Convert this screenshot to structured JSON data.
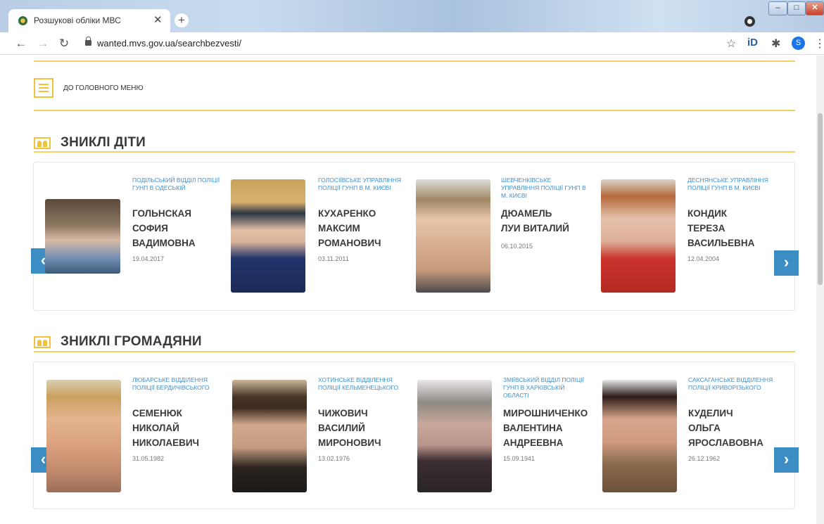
{
  "browser": {
    "tab_title": "Розшукові обліки МВС",
    "url": "wanted.mvs.gov.ua/searchbezvesti/",
    "profile_initial": "S"
  },
  "page": {
    "menu_link": "ДО ГОЛОВНОГО МЕНЮ",
    "sections": [
      {
        "title": "ЗНИКЛІ ДІТИ",
        "cards": [
          {
            "dept": "ПОДІЛЬСЬКИЙ ВІДДІЛ ПОЛІЦІЇ ГУНП В ОДЕСЬКІЙ",
            "name": [
              "ГОЛЬНСКАЯ",
              "СОФИЯ",
              "ВАДИМОВНА"
            ],
            "date": "19.04.2017"
          },
          {
            "dept": "ГОЛОСІЇВСЬКЕ УПРАВЛІННЯ ПОЛІЦІЇ ГУНП В М. КИЄВІ",
            "name": [
              "КУХАРЕНКО",
              "МАКСИМ",
              "РОМАНОВИЧ"
            ],
            "date": "03.11.2011"
          },
          {
            "dept": "ШЕВЧЕНКІВСЬКЕ УПРАВЛІННЯ ПОЛІЦІЇ ГУНП В М. КИЄВІ",
            "name": [
              "ДЮАМЕЛЬ",
              "ЛУИ ВИТАЛИЙ"
            ],
            "date": "06.10.2015"
          },
          {
            "dept": "ДЕСНЯНСЬКЕ УПРАВЛІННЯ ПОЛІЦІЇ ГУНП В М. КИЄВІ",
            "name": [
              "КОНДИК",
              "ТЕРЕЗА",
              "ВАСИЛЬЕВНА"
            ],
            "date": "12.04.2004"
          }
        ]
      },
      {
        "title": "ЗНИКЛІ ГРОМАДЯНИ",
        "cards": [
          {
            "dept": "ЛЮБАРСЬКЕ ВІДДІЛЕННЯ ПОЛІЦІЇ БЕРДИЧІВСЬКОГО",
            "name": [
              "СЕМЕНЮК",
              "НИКОЛАЙ",
              "НИКОЛАЕВИЧ"
            ],
            "date": "31.05.1982"
          },
          {
            "dept": "ХОТИНСЬКЕ ВІДДІЛЕННЯ ПОЛІЦІЇ КЕЛЬМЕНЕЦЬКОГО",
            "name": [
              "ЧИЖОВИЧ",
              "ВАСИЛИЙ",
              "МИРОНОВИЧ"
            ],
            "date": "13.02.1976"
          },
          {
            "dept": "ЗМІЇВСЬКИЙ ВІДДІЛ ПОЛІЦІЇ ГУНП В ХАРКІВСЬКІЙ ОБЛАСТІ",
            "name": [
              "МИРОШНИЧЕНКО",
              "ВАЛЕНТИНА",
              "АНДРЕЕВНА"
            ],
            "date": "15.09.1941"
          },
          {
            "dept": "САКСАГАНСЬКЕ ВІДДІЛЕННЯ ПОЛІЦІЇ КРИВОРІЗЬКОГО",
            "name": [
              "КУДЕЛИЧ",
              "ОЛЬГА",
              "ЯРОСЛАВОВНА"
            ],
            "date": "26.12.1962"
          }
        ]
      }
    ]
  }
}
